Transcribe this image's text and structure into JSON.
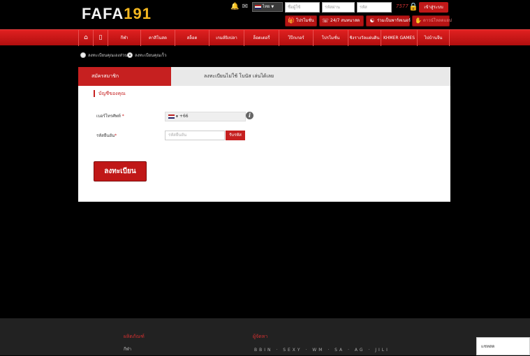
{
  "header": {
    "logo_part1": "FAFA",
    "logo_part2": "191",
    "bell_icon": "bell-icon",
    "mail_icon": "mail-icon",
    "language": "ไทย",
    "username_placeholder": "ชื่อผู้ใช้",
    "password_placeholder": "รหัสผ่าน",
    "code_placeholder": "รหัส",
    "captcha_code": "7577",
    "login_label": "เข้าสู่ระบบ",
    "buttons": {
      "promotions": "โปรโมชั่น",
      "support": "24/7 สนทนาสด",
      "affiliate": "ร่วมเป็นพาร์ทเนอร์",
      "download": "ดาวน์โหลดแอป"
    }
  },
  "nav": {
    "home_icon": "home-icon",
    "mobile_icon": "mobile-icon",
    "items": [
      "กีฬา",
      "คาสิโนสด",
      "สล็อต",
      "เกมส์ยิงปลา",
      "ล็อตเตอรี่",
      "โป๊กเกอร์",
      "โปรโมชั่น",
      "ชิงรางวัลแผ่นดิน",
      "KHMER GAMES",
      "ไปบ้านจีน"
    ]
  },
  "register_mode": {
    "options": [
      "ลงทะเบียนคุณเองส่วน",
      "ลงทะเบียนคุณเร็ว"
    ],
    "selected_index": 1
  },
  "panel": {
    "tab_active": "สมัครสมาชิก",
    "tab_other": "ลงทะเบียนไม่ใช้ โบนัส เล่นได้เลย",
    "section_title": "บัญชีของคุณ",
    "phone_label": "เบอร์โทรศัพท์",
    "phone_required_mark": "*",
    "phone_prefix": "+66",
    "info_icon": "info-icon",
    "otp_label": "รหัสยืนยัน",
    "otp_required_mark": "*",
    "otp_placeholder": "รหัสยืนยัน",
    "otp_button": "รับรหัส",
    "register_button": "ลงทะเบียน"
  },
  "footer": {
    "products_heading": "ผลิตภัณฑ์",
    "products_link": "กีฬา",
    "partners_heading": "ผู้จัดหา",
    "partner_logos": "BBIN  ·  SEXY  ·  WM  ·  SA  ·  AG  ·  JILI"
  },
  "chat": {
    "label": "แชทสด"
  }
}
